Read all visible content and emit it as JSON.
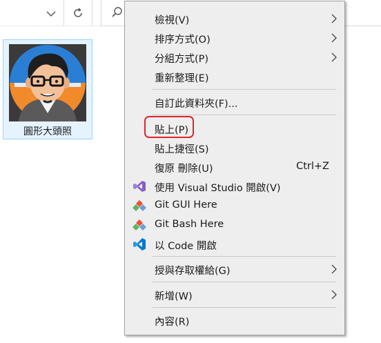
{
  "toolbar": {
    "dropdown_icon": "chevron-down-icon",
    "refresh_icon": "refresh-icon",
    "search_icon": "search-icon"
  },
  "file": {
    "name": "圓形大頭照",
    "thumbnail_icon": "avatar-cartoon-image"
  },
  "menu": {
    "view": "檢視(V)",
    "sort_by": "排序方式(O)",
    "group_by": "分組方式(P)",
    "refresh": "重新整理(E)",
    "customize_folder": "自訂此資料夾(F)...",
    "paste": "貼上(P)",
    "paste_shortcut": "貼上捷徑(S)",
    "undo_delete": "復原 刪除(U)",
    "undo_delete_key": "Ctrl+Z",
    "open_visual_studio": "使用 Visual Studio 開啟(V)",
    "git_gui": "Git GUI Here",
    "git_bash": "Git Bash Here",
    "open_with_code": "以 Code 開啟",
    "give_access": "授與存取權給(G)",
    "new": "新增(W)",
    "properties": "內容(R)"
  },
  "colors": {
    "menu_bg": "#eeeeee",
    "highlight_ring": "#e0242b",
    "selection_bg": "#e5f3ff",
    "selection_border": "#99d1ff",
    "vs_purple": "#865fc5",
    "vscode_blue": "#007acc",
    "git_orange": "#f05033"
  }
}
